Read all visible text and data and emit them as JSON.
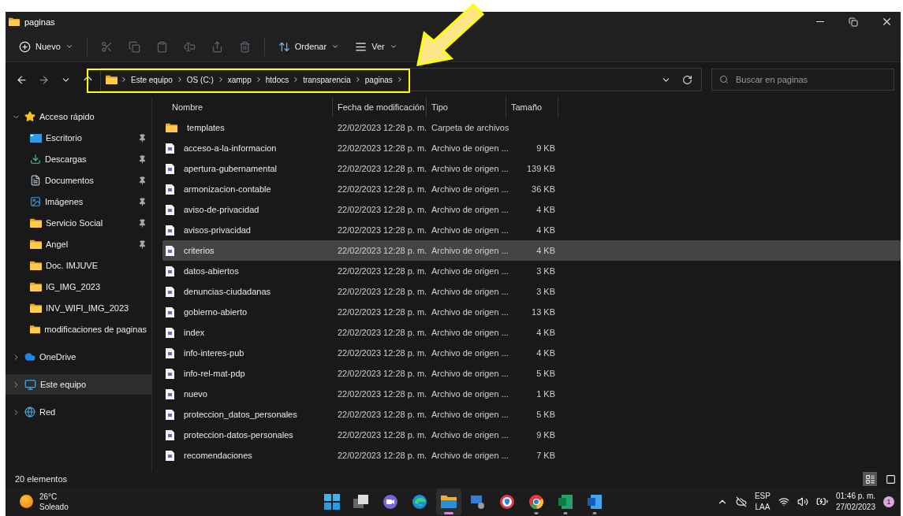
{
  "window": {
    "title": "paginas"
  },
  "toolbar": [
    {
      "kind": "new",
      "label": "Nuevo",
      "disabled": false
    },
    {
      "kind": "cut",
      "disabled": true
    },
    {
      "kind": "copy",
      "disabled": true
    },
    {
      "kind": "paste",
      "disabled": true
    },
    {
      "kind": "rename",
      "disabled": true
    },
    {
      "kind": "share",
      "disabled": true
    },
    {
      "kind": "delete",
      "disabled": true
    },
    {
      "kind": "sort",
      "label": "Ordenar",
      "disabled": false
    },
    {
      "kind": "view",
      "label": "Ver",
      "disabled": false
    }
  ],
  "address": {
    "path": [
      "Este equipo",
      "OS (C:)",
      "xampp",
      "htdocs",
      "transparencia",
      "paginas"
    ]
  },
  "search": {
    "placeholder": "Buscar en paginas"
  },
  "sidebar": [
    {
      "kind": "star",
      "label": "Acceso rápido",
      "expanded": true,
      "selected": false,
      "children": [
        {
          "kind": "desktop",
          "label": "Escritorio",
          "pinned": true
        },
        {
          "kind": "download",
          "label": "Descargas",
          "pinned": true
        },
        {
          "kind": "documents",
          "label": "Documentos",
          "pinned": true
        },
        {
          "kind": "pictures",
          "label": "Imágenes",
          "pinned": true
        },
        {
          "kind": "folder",
          "label": "Servicio Social",
          "pinned": true
        },
        {
          "kind": "folder",
          "label": "Angel",
          "pinned": true
        },
        {
          "kind": "folder",
          "label": "Doc. IMJUVE",
          "pinned": false
        },
        {
          "kind": "folder",
          "label": "IG_IMG_2023",
          "pinned": false
        },
        {
          "kind": "folder",
          "label": "INV_WIFI_IMG_2023",
          "pinned": false
        },
        {
          "kind": "folder",
          "label": "modificaciones de paginas",
          "pinned": false
        }
      ]
    },
    {
      "kind": "cloud",
      "label": "OneDrive",
      "expanded": false,
      "selected": false
    },
    {
      "kind": "pc",
      "label": "Este equipo",
      "expanded": false,
      "selected": true
    },
    {
      "kind": "network",
      "label": "Red",
      "expanded": false,
      "selected": false
    }
  ],
  "table": {
    "columns": [
      "Nombre",
      "Fecha de modificación",
      "Tipo",
      "Tamaño"
    ],
    "rows": [
      {
        "kind": "folder",
        "name": "templates",
        "date": "22/02/2023 12:28 p. m.",
        "type": "Carpeta de archivos",
        "selected": false
      },
      {
        "kind": "file",
        "name": "acceso-a-la-informacion",
        "date": "22/02/2023 12:28 p. m.",
        "type": "Archivo de origen ...",
        "size": "9 KB",
        "selected": false
      },
      {
        "kind": "file",
        "name": "apertura-gubernamental",
        "date": "22/02/2023 12:28 p. m.",
        "type": "Archivo de origen ...",
        "size": "139 KB",
        "selected": false
      },
      {
        "kind": "file",
        "name": "armonizacion-contable",
        "date": "22/02/2023 12:28 p. m.",
        "type": "Archivo de origen ...",
        "size": "36 KB",
        "selected": false
      },
      {
        "kind": "file",
        "name": "aviso-de-privacidad",
        "date": "22/02/2023 12:28 p. m.",
        "type": "Archivo de origen ...",
        "size": "4 KB",
        "selected": false
      },
      {
        "kind": "file",
        "name": "avisos-privacidad",
        "date": "22/02/2023 12:28 p. m.",
        "type": "Archivo de origen ...",
        "size": "4 KB",
        "selected": false
      },
      {
        "kind": "file",
        "name": "criterios",
        "date": "22/02/2023 12:28 p. m.",
        "type": "Archivo de origen ...",
        "size": "4 KB",
        "selected": true
      },
      {
        "kind": "file",
        "name": "datos-abiertos",
        "date": "22/02/2023 12:28 p. m.",
        "type": "Archivo de origen ...",
        "size": "3 KB",
        "selected": false
      },
      {
        "kind": "file",
        "name": "denuncias-ciudadanas",
        "date": "22/02/2023 12:28 p. m.",
        "type": "Archivo de origen ...",
        "size": "3 KB",
        "selected": false
      },
      {
        "kind": "file",
        "name": "gobierno-abierto",
        "date": "22/02/2023 12:28 p. m.",
        "type": "Archivo de origen ...",
        "size": "13 KB",
        "selected": false
      },
      {
        "kind": "file",
        "name": "index",
        "date": "22/02/2023 12:28 p. m.",
        "type": "Archivo de origen ...",
        "size": "4 KB",
        "selected": false
      },
      {
        "kind": "file",
        "name": "info-interes-pub",
        "date": "22/02/2023 12:28 p. m.",
        "type": "Archivo de origen ...",
        "size": "4 KB",
        "selected": false
      },
      {
        "kind": "file",
        "name": "info-rel-mat-pdp",
        "date": "22/02/2023 12:28 p. m.",
        "type": "Archivo de origen ...",
        "size": "5 KB",
        "selected": false
      },
      {
        "kind": "file",
        "name": "nuevo",
        "date": "22/02/2023 12:28 p. m.",
        "type": "Archivo de origen ...",
        "size": "1 KB",
        "selected": false
      },
      {
        "kind": "file",
        "name": "proteccion_datos_personales",
        "date": "22/02/2023 12:28 p. m.",
        "type": "Archivo de origen ...",
        "size": "5 KB",
        "selected": false
      },
      {
        "kind": "file",
        "name": "proteccion-datos-personales",
        "date": "22/02/2023 12:28 p. m.",
        "type": "Archivo de origen ...",
        "size": "9 KB",
        "selected": false
      },
      {
        "kind": "file",
        "name": "recomendaciones",
        "date": "22/02/2023 12:28 p. m.",
        "type": "Archivo de origen ...",
        "size": "7 KB",
        "selected": false
      }
    ]
  },
  "status_bar": {
    "count": "20 elementos",
    "views": [
      {
        "kind": "details",
        "selected": true
      },
      {
        "kind": "tiles",
        "selected": false
      }
    ]
  },
  "taskbar": {
    "weather": {
      "temperature": "26°C",
      "condition": "Soleado"
    },
    "apps": [
      {
        "kind": "start",
        "running": false,
        "selected": false
      },
      {
        "kind": "task-view",
        "running": false,
        "selected": false
      },
      {
        "kind": "chat",
        "running": false,
        "selected": false
      },
      {
        "kind": "edge",
        "running": false,
        "selected": false
      },
      {
        "kind": "explorer",
        "running": true,
        "selected": true
      },
      {
        "kind": "remote",
        "running": false,
        "selected": false
      },
      {
        "kind": "browser",
        "running": false,
        "selected": false
      },
      {
        "kind": "chrome",
        "running": true,
        "selected": false
      },
      {
        "kind": "excel",
        "running": true,
        "selected": false
      },
      {
        "kind": "word",
        "running": true,
        "selected": false
      }
    ],
    "language": [
      "ESP",
      "LAA"
    ],
    "time": "01:46 p. m.",
    "date": "27/02/2023",
    "notifications": "1"
  }
}
